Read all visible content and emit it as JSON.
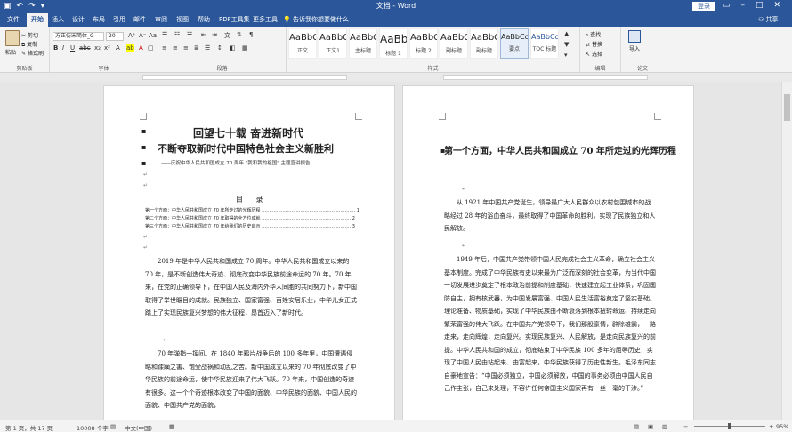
{
  "titlebar": {
    "title": "文档 - Word",
    "login": "登录",
    "qa_icons": [
      "save-icon",
      "undo-icon",
      "redo-icon"
    ]
  },
  "tabs": [
    "文件",
    "开始",
    "插入",
    "设计",
    "布局",
    "引用",
    "邮件",
    "审阅",
    "视图",
    "帮助",
    "PDF工具集",
    "更多工具"
  ],
  "active_tab": "开始",
  "tell_me": "告诉我你想要做什么",
  "share": "共享",
  "clipboard": {
    "paste": "粘贴",
    "cut": "剪切",
    "copy": "复制",
    "format_painter": "格式刷",
    "label": "剪贴板"
  },
  "font": {
    "name": "方正仿宋简体_G",
    "size": "20",
    "label": "字体"
  },
  "paragraph": {
    "label": "段落"
  },
  "styles": {
    "label": "样式",
    "items": [
      {
        "sample": "AaBbC",
        "name": "正文"
      },
      {
        "sample": "AaBbCc",
        "name": "正文1"
      },
      {
        "sample": "AaBbC",
        "name": "主标题"
      },
      {
        "sample": "AaBb",
        "name": "标题 1"
      },
      {
        "sample": "AaBbC",
        "name": "标题 2"
      },
      {
        "sample": "AaBbC",
        "name": "副标题"
      },
      {
        "sample": "AaBbC",
        "name": "副标题"
      },
      {
        "sample": "AaBbCcD",
        "name": "要点"
      },
      {
        "sample": "AaBbCc",
        "name": "TOC 标题"
      }
    ]
  },
  "editing": {
    "find": "查找",
    "replace": "替换",
    "select": "选择",
    "label": "编辑"
  },
  "extra": {
    "import": "导入",
    "translate": "论文查重",
    "label": "论文"
  },
  "page1": {
    "title1": "回望七十载  奋进新时代",
    "title2": "不断夺取新时代中国特色社会主义新胜利",
    "subtitle": "——庆祝中华人民共和国成立 70 周年 \"我和我的祖国\" 主题宣讲报告",
    "toc_heading": "目  录",
    "toc": [
      "第一个方面：中华人民共和国成立 70 年所走过的光辉历程 ……………………………………………………… 1",
      "第二个方面：中华人民共和国成立 70 年取得的全方位成就 …………………………………………………… 2",
      "第三个方面：中华人民共和国成立 70 年给我们的历史启示 …………………………………………………… 3"
    ],
    "para1": "　　2019 年是中华人民共和国成立 70 周年。中华人民共和国成立以来的 70 年，是不断创造伟大奇迹、彻底改变中华民族前途命运的 70 年。70 年来，在党的正确领导下，在中国人民及海内外华人同胞的共同努力下，新中国取得了举世瞩目的成就。民族独立、国家富强、百姓安居乐业，中华儿女正式踏上了实现民族复兴梦想的伟大征程，昂首迈入了新时代。",
    "para2": "　　70 年弹指一挥间。在 1840 年鸦片战争后的 100 多年里，中国遭遇侵略和蹂躏之害、饱受战祸和动乱之苦。新中国成立以来的 70 年彻底改变了中华民族的前途命运，使中华民族迎来了伟大飞跃。70 年来，中国创造的奇迹有很多。这一个个奇迹根本改变了中国的面貌、中华民族的面貌、中国人民的面貌、中国共产党的面貌，"
  },
  "page2": {
    "heading": "第一个方面，中华人民共和国成立 70 年所走过的光辉历程",
    "para1": "　　从 1921 年中国共产党诞生，领导最广大人民群众以农村包围城市的战略经过 28 年的浴血奋斗，最终取得了中国革命的胜利，实现了民族独立和人民解放。",
    "para2": "　　1949 年后，中国共产党带领中国人民完成社会主义革命，确立社会主义基本制度。完成了中华民族有史以来最为广泛而深刻的社会变革，为当代中国一切发展进步奠定了根本政治前提和制度基础，快速建立起工业体系，巩固国防自主，拥有核武器，为中国发展富强、中国人民生活富裕奠定了坚实基础。理论准备、物质基础，实现了中华民族由不断衰落到根本扭转命运、持续走向繁荣富强的伟大飞跃。在中国共产党领导下，我们那股豪情，辟除雄霸，一路走来，走向辉煌，走向复兴。实现民族复兴、人民解放，是走向民族复兴的前提。中华人民共和国的成立，彻底结束了中华民族 100 多年的屈辱历史，实现了中国人民由站起来、由富起来，中华民族获得了历史性新生。毛泽东同志自豪地宣告：“中国必须独立，中国必须解放，中国的事务必须由中国人民自己作主张，自己来处理，不容许任何帝国主义国家再有一丝一毫的干涉。”"
  },
  "status": {
    "page": "第 1 页，共 17 页",
    "words": "10008 个字",
    "lang": "中文(中国)",
    "zoom": "95%"
  }
}
